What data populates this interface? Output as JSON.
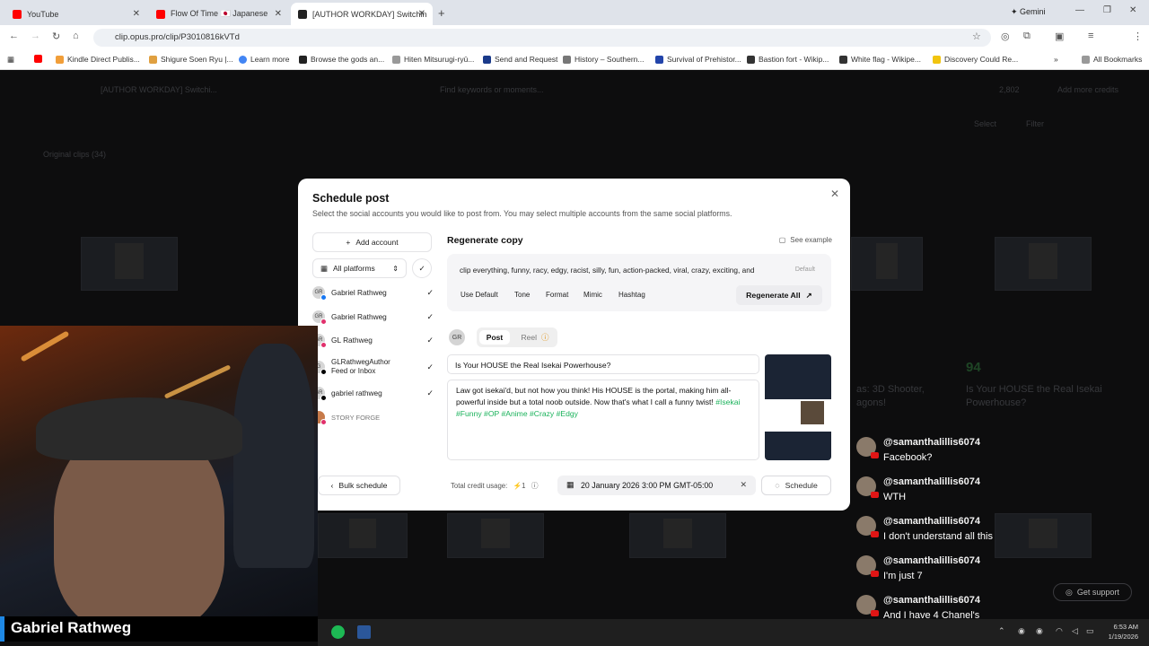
{
  "browser": {
    "tabs": [
      {
        "label": "YouTube",
        "fav_color": "#ff0000"
      },
      {
        "label": "Flow Of Time 🇯🇵 Japanese",
        "fav_color": "#ff0000"
      },
      {
        "label": "[AUTHOR WORKDAY] Switchin",
        "fav_color": "#222222"
      }
    ],
    "new_tab": "+",
    "gemini": "Gemini",
    "url": "clip.opus.pro/clip/P3010816kVTd",
    "bookmarks": [
      {
        "label": "Kindle Direct Publis...",
        "color": "#f19e39"
      },
      {
        "label": "Shigure Soen Ryu |...",
        "color": "#e0a040"
      },
      {
        "label": "Learn more",
        "color": "#4285f4"
      },
      {
        "label": "Browse the gods an...",
        "color": "#222222"
      },
      {
        "label": "Hiten Mitsurugi-ryū...",
        "color": "#999999"
      },
      {
        "label": "Send and Request",
        "color": "#1a3a8a"
      },
      {
        "label": "History – Southern...",
        "color": "#777777"
      },
      {
        "label": "Survival of Prehistor...",
        "color": "#2244aa"
      },
      {
        "label": "Bastion fort - Wikip...",
        "color": "#333333"
      },
      {
        "label": "White flag - Wikipe...",
        "color": "#333333"
      },
      {
        "label": "Discovery Could Re...",
        "color": "#f1c40f"
      }
    ],
    "all_bookmarks": "All Bookmarks"
  },
  "app": {
    "breadcrumb": "[AUTHOR WORKDAY] Switchi...",
    "search_placeholder": "Find keywords or moments...",
    "credits": "2,802",
    "add_credits": "Add more credits",
    "select": "Select",
    "filter": "Filter",
    "section": "Original clips (34)",
    "score": "94",
    "card_title_right": "Is Your HOUSE the Real Isekai Powerhouse?",
    "card_title_mid": "as: 3D Shooter, agons!"
  },
  "modal": {
    "title": "Schedule post",
    "subtitle": "Select the social accounts you would like to post from. You may select multiple accounts from the same social platforms.",
    "add_account": "Add account",
    "all_platforms": "All platforms",
    "accounts": [
      {
        "name": "Gabriel Rathweg",
        "initials": "GR",
        "badge": "#1877f2",
        "checked": "✓"
      },
      {
        "name": "Gabriel Rathweg",
        "initials": "GR",
        "badge": "#e1306c",
        "checked": "✓"
      },
      {
        "name": "GL Rathweg",
        "initials": "GR",
        "badge": "#e1306c",
        "checked": "✓"
      },
      {
        "name": "GLRathwegAuthor Feed or Inbox",
        "initials": "G",
        "badge": "#000000",
        "checked": "✓"
      },
      {
        "name": "gabriel rathweg",
        "initials": "GR",
        "badge": "#000000",
        "checked": "✓"
      },
      {
        "name": "STORY FORGE",
        "initials": "",
        "badge": "#e1306c",
        "checked": ""
      }
    ],
    "regen_title": "Regenerate copy",
    "see_example": "See example",
    "copy_text": "clip everything, funny, racy, edgy, racist, silly, fun, action-packed, viral, crazy, exciting, and",
    "copy_overlay": "Default",
    "chips": [
      "Use Default",
      "Tone",
      "Format",
      "Mimic",
      "Hashtag"
    ],
    "regen_all": "Regenerate All",
    "post_tab": "Post",
    "reel_tab": "Reel",
    "post_title": "Is Your HOUSE the Real Isekai Powerhouse?",
    "post_body": "Law got isekai'd, but not how you think! His HOUSE is the portal, making him all-powerful inside but a total noob outside. Now that's what I call a funny twist!",
    "post_tags": "#Isekai #Funny #OP #Anime #Crazy #Edgy",
    "bulk": "Bulk schedule",
    "credit_label": "Total credit usage:",
    "credit_value": "1",
    "date": "20 January 2026 3:00 PM GMT-05:00",
    "schedule": "Schedule"
  },
  "stream": {
    "name": "Gabriel Rathweg",
    "support": "Get support",
    "chat": [
      {
        "user": "@samanthalillis6074",
        "msg": "Facebook?"
      },
      {
        "user": "@samanthalillis6074",
        "msg": "WTH"
      },
      {
        "user": "@samanthalillis6074",
        "msg": "I don't understand all this"
      },
      {
        "user": "@samanthalillis6074",
        "msg": "I'm just 7"
      },
      {
        "user": "@samanthalillis6074",
        "msg": "And I have 4 Chanel's"
      }
    ]
  },
  "taskbar": {
    "time": "6:53 AM",
    "date": "1/19/2026"
  }
}
